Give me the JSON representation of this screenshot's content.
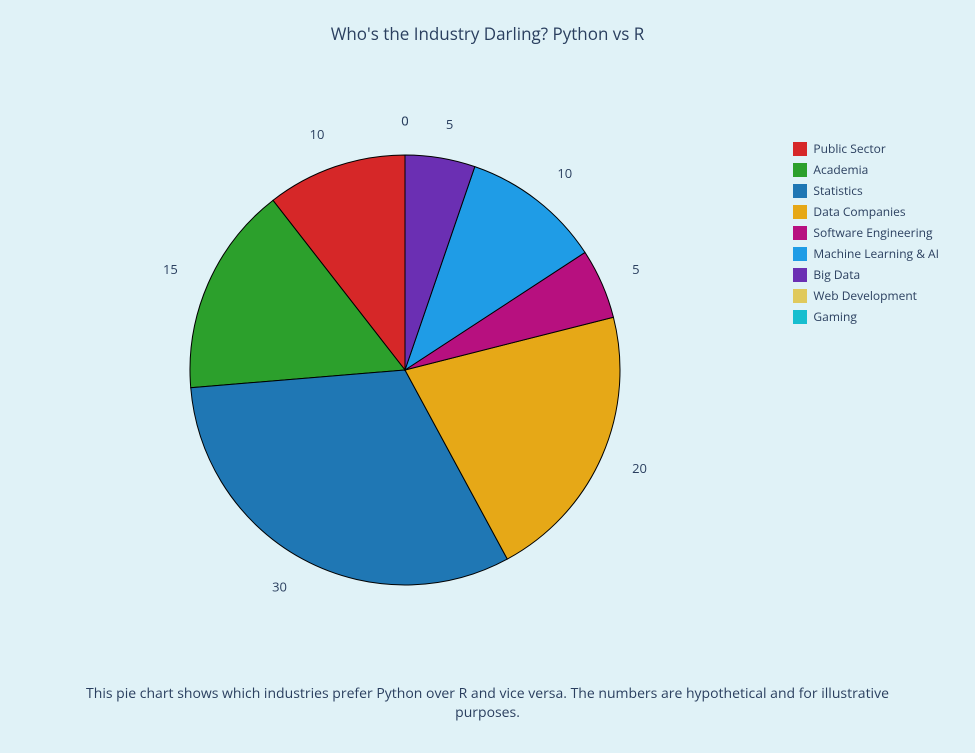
{
  "title": "Who's the Industry Darling? Python vs R",
  "caption": "This pie chart shows which industries prefer Python over R and vice versa. The numbers are hypothetical and for illustrative purposes.",
  "chart_data": {
    "type": "pie",
    "title": "Who's the Industry Darling? Python vs R",
    "series": [
      {
        "name": "Public Sector",
        "value": 10,
        "color": "#d62728"
      },
      {
        "name": "Academia",
        "value": 15,
        "color": "#2ca02c"
      },
      {
        "name": "Statistics",
        "value": 30,
        "color": "#1f77b4"
      },
      {
        "name": "Data Companies",
        "value": 20,
        "color": "#e6a817"
      },
      {
        "name": "Software Engineering",
        "value": 5,
        "color": "#b7107f"
      },
      {
        "name": "Machine Learning & AI",
        "value": 10,
        "color": "#1f9ce6"
      },
      {
        "name": "Big Data",
        "value": 5,
        "color": "#6b2fb3"
      },
      {
        "name": "Web Development",
        "value": 0,
        "color": "#e0c95c"
      },
      {
        "name": "Gaming",
        "value": 0,
        "color": "#17becf"
      }
    ],
    "legend_position": "right",
    "label_mode": "outside_values"
  }
}
